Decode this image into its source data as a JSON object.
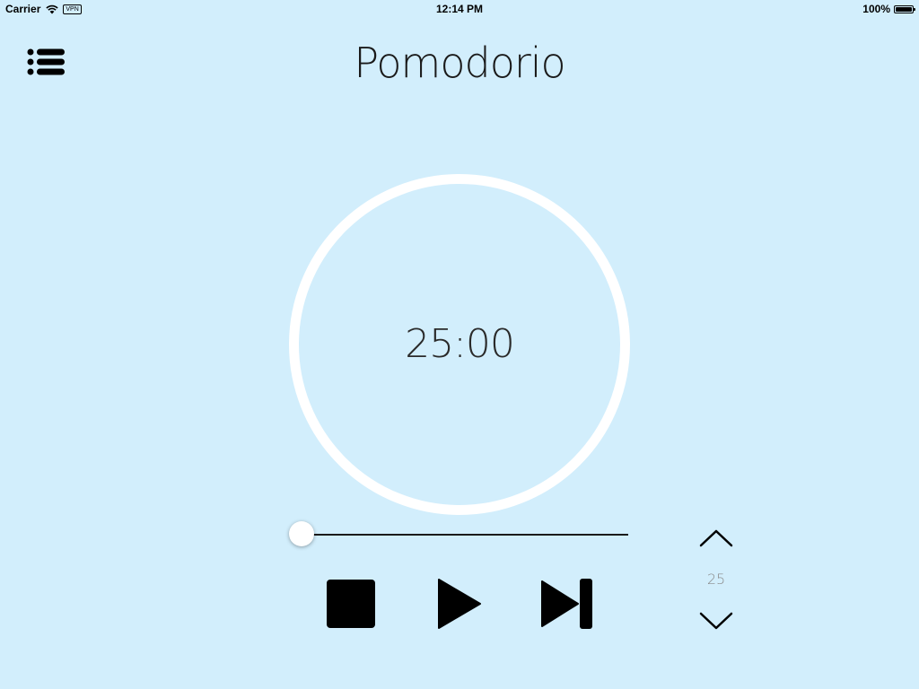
{
  "theme": {
    "background": "#d2eefc",
    "ring": "#ffffff",
    "foreground": "#000000"
  },
  "status_bar": {
    "carrier": "Carrier",
    "vpn": "VPN",
    "time": "12:14 PM",
    "battery": "100%",
    "battery_level": 1.0
  },
  "header": {
    "title": "Pomodorio",
    "menu_icon": "list-icon"
  },
  "timer": {
    "display": "25:00"
  },
  "slider": {
    "value": 0.0
  },
  "controls": {
    "stop_icon": "stop-icon",
    "play_icon": "play-icon",
    "skip_icon": "skip-forward-icon"
  },
  "stepper": {
    "value": "25",
    "up_icon": "chevron-up-icon",
    "down_icon": "chevron-down-icon"
  }
}
